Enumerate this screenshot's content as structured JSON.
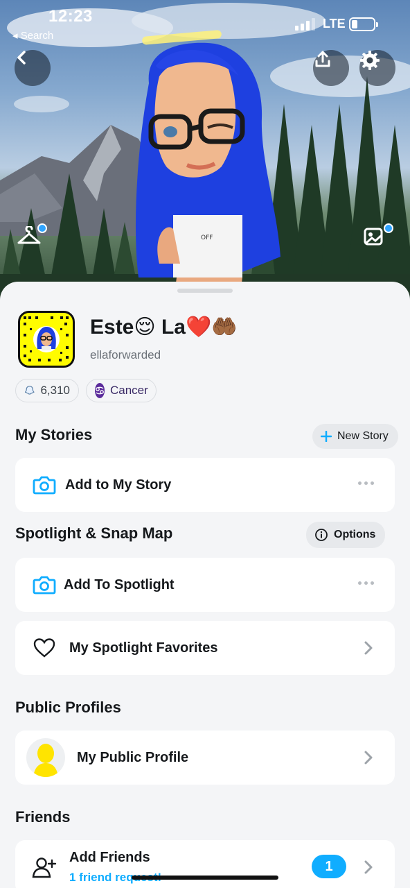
{
  "status_bar": {
    "time": "12:23",
    "back_label": "◂ Search",
    "network": "LTE",
    "battery_level": 0.25
  },
  "header": {
    "back_icon": "chevron-left-icon",
    "share_icon": "upload-icon",
    "settings_icon": "gear-icon",
    "outfit_icon": "hanger-icon",
    "background_icon": "image-icon"
  },
  "profile": {
    "display_name": "Este😌 La❤️🤲🏾",
    "username": "ellaforwarded",
    "score": "6,310",
    "zodiac": "Cancer"
  },
  "my_stories": {
    "title": "My Stories",
    "new_story_label": "New Story",
    "add_story_label": "Add to My Story"
  },
  "spotlight": {
    "title": "Spotlight & Snap Map",
    "options_label": "Options",
    "add_label": "Add To Spotlight",
    "favorites_label": "My Spotlight Favorites"
  },
  "public_profiles": {
    "title": "Public Profiles",
    "my_profile_label": "My Public Profile"
  },
  "friends": {
    "title": "Friends",
    "add_friends_label": "Add Friends",
    "requests_label": "1 friend request!",
    "badge_count": "1"
  },
  "colors": {
    "accent_blue": "#10adff",
    "snap_yellow": "#fffc00",
    "zodiac_purple": "#5b2b9b"
  }
}
